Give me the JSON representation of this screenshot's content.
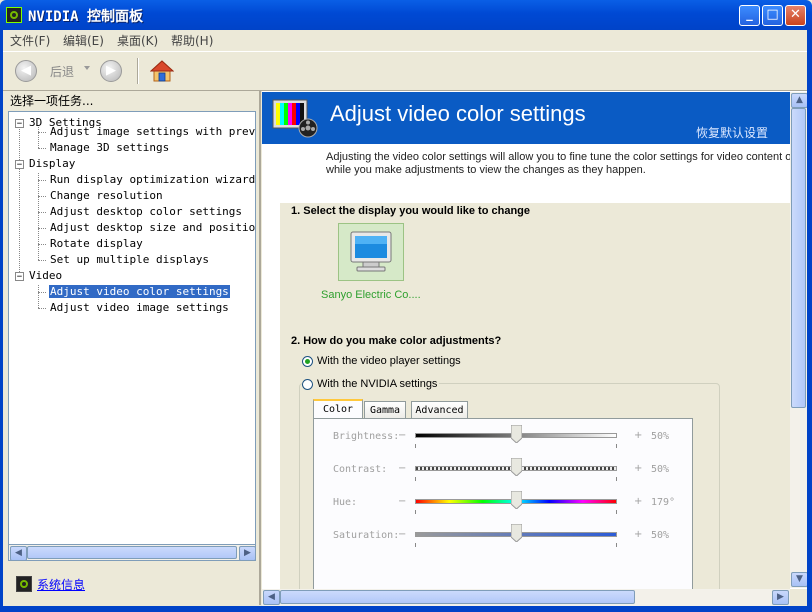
{
  "window": {
    "title": "NVIDIA 控制面板"
  },
  "menu": {
    "items": [
      "文件(F)",
      "编辑(E)",
      "桌面(K)",
      "帮助(H)"
    ]
  },
  "toolbar": {
    "back_label": "后退"
  },
  "left_pane": {
    "header": "选择一项任务...",
    "tree": [
      {
        "label": "3D Settings",
        "items": [
          "Adjust image settings with preview",
          "Manage 3D settings"
        ]
      },
      {
        "label": "Display",
        "items": [
          "Run display optimization wizard",
          "Change resolution",
          "Adjust desktop color settings",
          "Adjust desktop size and position",
          "Rotate display",
          "Set up multiple displays"
        ]
      },
      {
        "label": "Video",
        "items": [
          "Adjust video color settings",
          "Adjust video image settings"
        ]
      }
    ],
    "selected_item": "Adjust video color settings",
    "sysinfo_link": "系统信息"
  },
  "page": {
    "title": "Adjust video color settings",
    "restore_defaults": "恢复默认设置",
    "intro_line1": "Adjusting the video color settings will allow you to fine tune the color settings for video content on y",
    "intro_line2": "while you make adjustments to view the changes as they happen.",
    "section1_title": "1. Select the display you would like to change",
    "display_name": "Sanyo Electric Co....",
    "section2_title": "2. How do you make color adjustments?",
    "radio_player": "With the video player settings",
    "radio_nvidia": "With the NVIDIA settings",
    "selected_radio": "player",
    "tabs": [
      "Color",
      "Gamma",
      "Advanced"
    ],
    "active_tab": "Color",
    "sliders": [
      {
        "label": "Brightness:",
        "value_text": "50%",
        "position": 0.5,
        "track": "brightness"
      },
      {
        "label": "Contrast:",
        "value_text": "50%",
        "position": 0.5,
        "track": "contrast"
      },
      {
        "label": "Hue:",
        "value_text": "179°",
        "position": 0.5,
        "track": "hue"
      },
      {
        "label": "Saturation:",
        "value_text": "50%",
        "position": 0.5,
        "track": "saturation"
      }
    ]
  },
  "colors": {
    "titlebar": "#0049D4",
    "banner": "#0A5BC4",
    "selection": "#316AC5",
    "display_label": "#2FA02F",
    "link": "#0000FF"
  }
}
